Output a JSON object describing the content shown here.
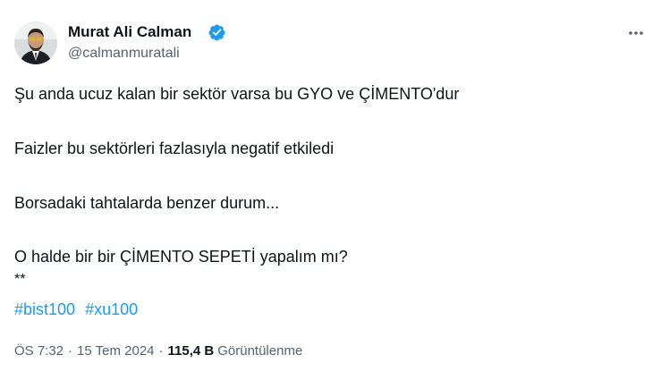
{
  "author": {
    "name": "Murat Ali Calman",
    "handle": "@calmanmuratali",
    "verified": true,
    "verified_color": "#1d9bf0"
  },
  "more_icon": "more-horizontal-icon",
  "tweet": {
    "line1": "Şu anda ucuz kalan bir sektör varsa bu GYO ve ÇİMENTO'dur",
    "line2": "Faizler bu sektörleri fazlasıyla negatif etkiledi",
    "line3": "Borsadaki tahtalarda benzer durum...",
    "line4": "O halde bir bir ÇİMENTO SEPETİ yapalım mı?",
    "line5": "**",
    "hashtags": [
      "#bist100",
      "#xu100"
    ],
    "hashtag_color": "#1d9bf0"
  },
  "meta": {
    "time": "ÖS 7:32",
    "date": "15 Tem 2024",
    "separator": "·",
    "views_count": "115,4 B",
    "views_label": "Görüntülenme"
  }
}
